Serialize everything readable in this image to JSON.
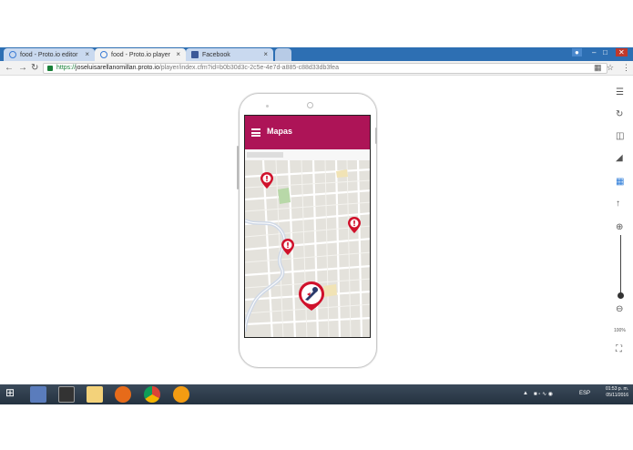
{
  "browser": {
    "tabs": [
      {
        "label": "food - Proto.io editor",
        "icon": "proto-io-icon"
      },
      {
        "label": "food - Proto.io player",
        "icon": "proto-io-icon"
      },
      {
        "label": "Facebook",
        "icon": "facebook-icon"
      }
    ],
    "url_scheme": "https://",
    "url_host": "joseluisarellanomillan.proto.io",
    "url_path": "/player/index.cfm?id=b0b30d3c-2c5e-4e7d-a885-c88d33db3fea",
    "window_controls": [
      "–",
      "□",
      "✕"
    ]
  },
  "app": {
    "title": "Mapas",
    "brand_color": "#ad1457",
    "markers": [
      {
        "type": "alert",
        "icon": "alert-pin-icon"
      },
      {
        "type": "alert",
        "icon": "alert-pin-icon"
      },
      {
        "type": "alert",
        "icon": "alert-pin-icon"
      },
      {
        "type": "user",
        "icon": "delivery-avatar-icon"
      }
    ]
  },
  "player_controls": {
    "zoom_label": "100%",
    "icons": [
      "menu-icon",
      "refresh-icon",
      "rotate-icon",
      "contrast-icon",
      "cursor-icon",
      "touch-icon",
      "zoom-in-icon",
      "zoom-out-icon",
      "fullscreen-icon"
    ]
  },
  "taskbar": {
    "lang": "ESP",
    "time": "01:53 p. m.",
    "date": "05/11/2016"
  }
}
